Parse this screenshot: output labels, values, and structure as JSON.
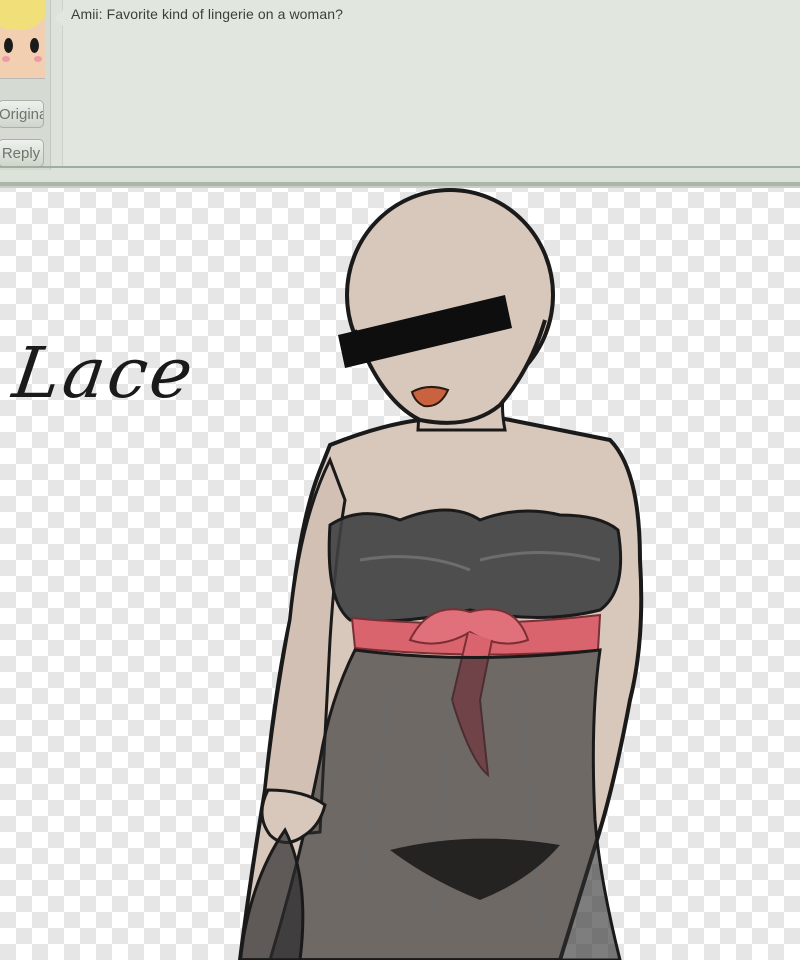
{
  "ask": {
    "message": "Amii: Favorite kind of lingerie on a woman?",
    "buttons": {
      "original_label": "Original",
      "reply_label": "Reply"
    }
  },
  "artwork": {
    "caption": "Lace"
  },
  "icons": {
    "avatar": "asker-avatar-icon"
  },
  "colors": {
    "panel_bg": "#dde3da",
    "skin": "#d8c7bb",
    "lingerie": "#3a3a3c",
    "ribbon": "#d9646e",
    "lips": "#c8623f"
  }
}
